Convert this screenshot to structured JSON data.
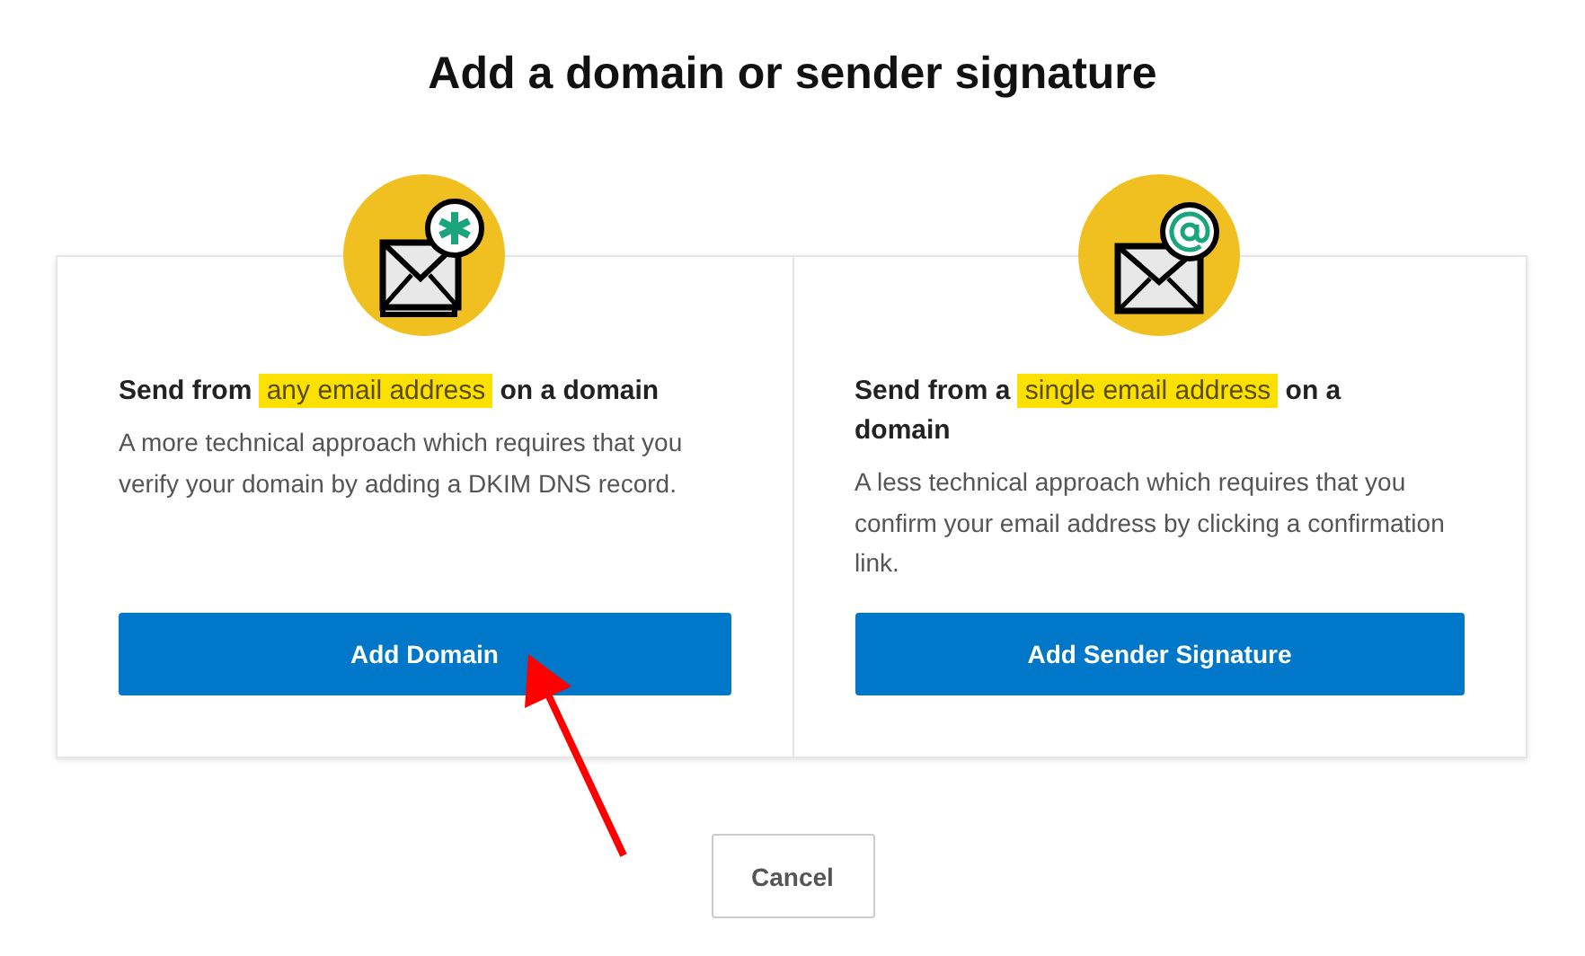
{
  "title": "Add a domain or sender signature",
  "options": [
    {
      "kind": "asterisk",
      "heading_before": "Send from",
      "heading_highlight": "any email address",
      "heading_after": "on a domain",
      "description": "A more technical approach which requires that you verify your domain by adding a DKIM DNS record.",
      "button": "Add Domain"
    },
    {
      "kind": "at",
      "heading_before": "Send from a",
      "heading_highlight": "single email address",
      "heading_after": "on a domain",
      "description": "A less technical approach which requires that you confirm your email address by clicking a confirmation link.",
      "button": "Add Sender Signature"
    }
  ],
  "cancel": "Cancel"
}
